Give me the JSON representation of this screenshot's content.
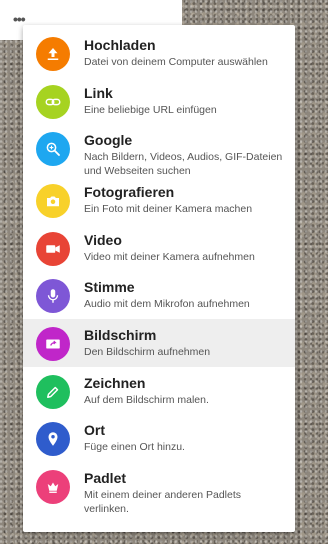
{
  "toolbar": {
    "more_label": "•••"
  },
  "menu": {
    "items": [
      {
        "title": "Hochladen",
        "subtitle": "Datei von deinem Computer auswählen",
        "icon": "upload-icon",
        "color": "#f57c00"
      },
      {
        "title": "Link",
        "subtitle": "Eine beliebige URL einfügen",
        "icon": "link-icon",
        "color": "#a6d321"
      },
      {
        "title": "Google",
        "subtitle": "Nach Bildern, Videos, Audios, GIF-Dateien und Webseiten suchen",
        "icon": "search-icon",
        "color": "#1ea7f0"
      },
      {
        "title": "Fotografieren",
        "subtitle": "Ein Foto mit deiner Kamera machen",
        "icon": "camera-icon",
        "color": "#f8d12a"
      },
      {
        "title": "Video",
        "subtitle": "Video mit deiner Kamera aufnehmen",
        "icon": "video-icon",
        "color": "#e84436"
      },
      {
        "title": "Stimme",
        "subtitle": "Audio mit dem Mikrofon aufnehmen",
        "icon": "microphone-icon",
        "color": "#7e57d6"
      },
      {
        "title": "Bildschirm",
        "subtitle": "Den Bildschirm aufnehmen",
        "icon": "screen-icon",
        "color": "#c026c9"
      },
      {
        "title": "Zeichnen",
        "subtitle": "Auf dem Bildschirm malen.",
        "icon": "pencil-icon",
        "color": "#1fbf5e"
      },
      {
        "title": "Ort",
        "subtitle": "Füge einen Ort hinzu.",
        "icon": "location-pin-icon",
        "color": "#2f5ccc"
      },
      {
        "title": "Padlet",
        "subtitle": "Mit einem deiner anderen Padlets verlinken.",
        "icon": "padlet-icon",
        "color": "#ec407a"
      }
    ]
  }
}
